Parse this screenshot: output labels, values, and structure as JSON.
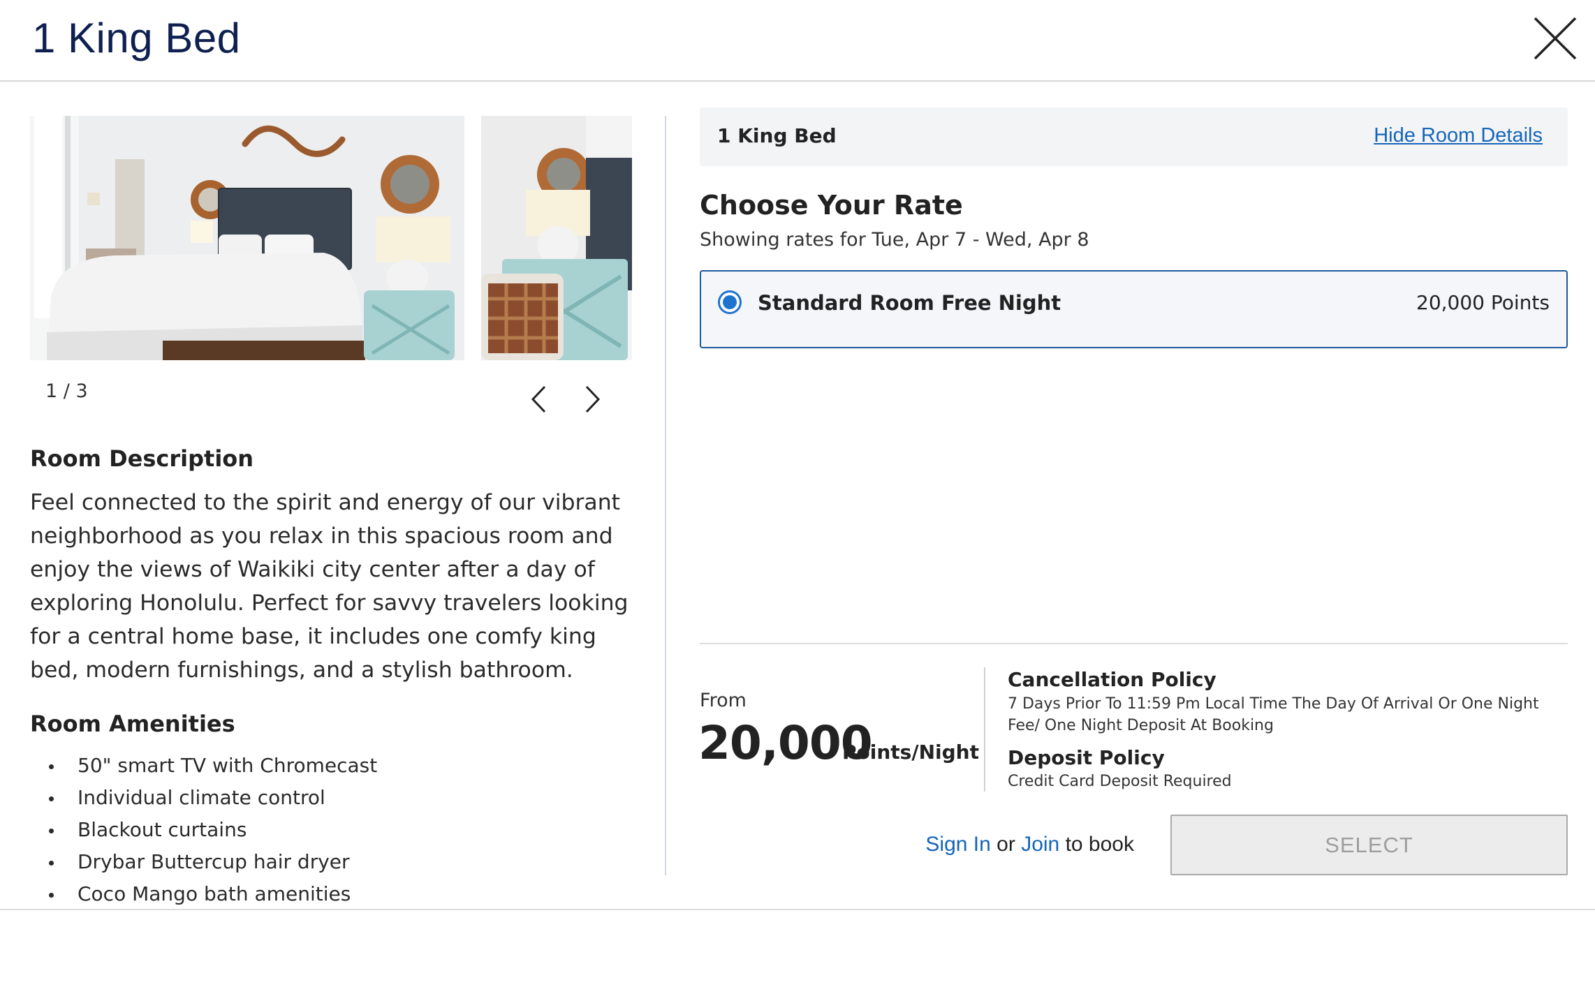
{
  "modal": {
    "title": "1 King Bed",
    "close_icon": "close-icon"
  },
  "gallery": {
    "counter": "1 / 3",
    "prev_icon": "chevron-left-icon",
    "next_icon": "chevron-right-icon"
  },
  "room_description": {
    "heading": "Room Description",
    "text": "Feel connected to the spirit and energy of our vibrant neighborhood as you relax in this spacious room and enjoy the views of Waikiki city center after a day of exploring Honolulu. Perfect for savvy travelers looking for a central home base, it includes one comfy king bed, modern furnishings, and a stylish bathroom."
  },
  "amenities": {
    "heading": "Room Amenities",
    "items": [
      "50\" smart TV with Chromecast",
      "Individual climate control",
      "Blackout curtains",
      "Drybar Buttercup hair dryer",
      "Coco Mango bath amenities"
    ]
  },
  "room_bar": {
    "name": "1 King Bed",
    "link": "Hide Room Details"
  },
  "rate": {
    "heading": "Choose Your Rate",
    "dates": "Showing rates for Tue, Apr 7 - Wed, Apr 8",
    "option": {
      "name": "Standard Room Free Night",
      "points": "20,000 Points",
      "selected": true
    }
  },
  "price": {
    "from_label": "From",
    "value": "20,000",
    "unit": "Points/Night"
  },
  "cancellation_policy": {
    "title": "Cancellation Policy",
    "text": "7 Days Prior To 11:59 Pm Local Time The Day Of Arrival Or One Night Fee/ One Night Deposit At Booking"
  },
  "deposit_policy": {
    "title": "Deposit Policy",
    "text": "Credit Card Deposit Required"
  },
  "booking": {
    "sign_in": "Sign In",
    "or": "or",
    "join": "Join",
    "to_book": "to book",
    "select_label": "SELECT"
  },
  "colors": {
    "title": "#0f2050",
    "link": "#1565b8",
    "radio": "#1e73d1",
    "selected_border": "#1c5a9a"
  }
}
